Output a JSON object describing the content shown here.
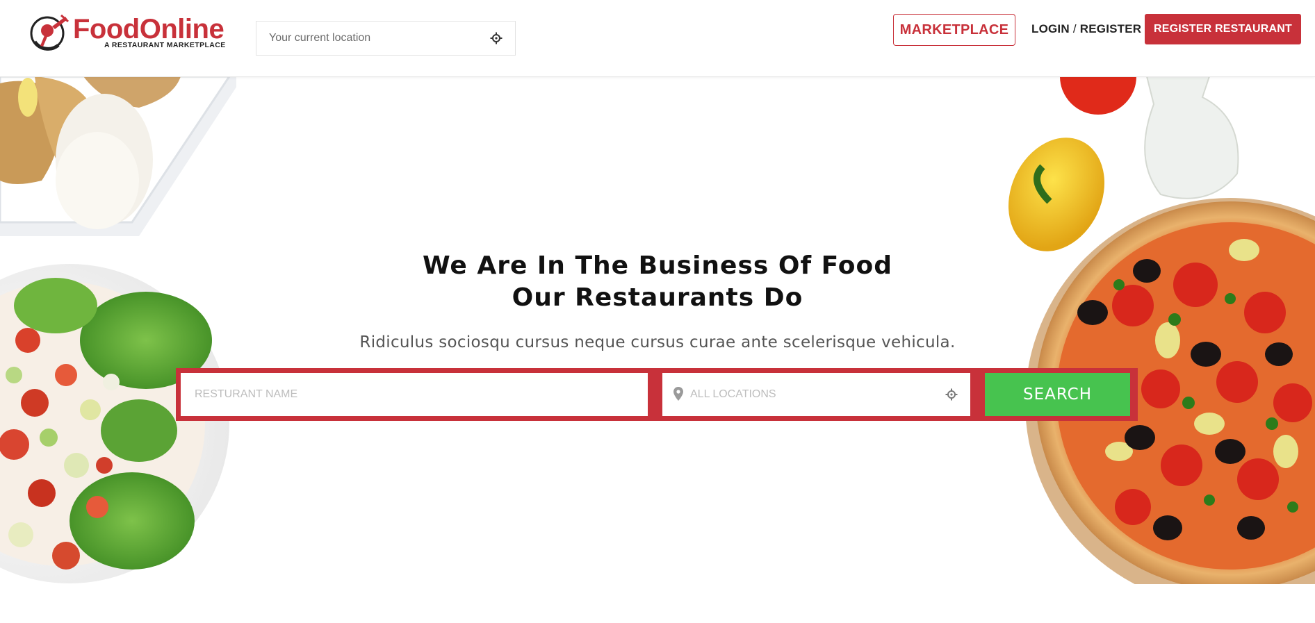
{
  "header": {
    "logo_name": "FoodOnline",
    "logo_tagline": "A RESTAURANT MARKETPLACE",
    "location_placeholder": "Your current location",
    "marketplace_label": "MARKETPLACE",
    "login_label": "LOGIN",
    "login_separator": "/",
    "register_label": "REGISTER",
    "register_restaurant_label": "REGISTER RESTAURANT"
  },
  "hero": {
    "headline_line1": "We Are In The Business Of Food",
    "headline_line2": "Our Restaurants Do",
    "subheading": "Ridiculus sociosqu cursus neque cursus curae ante scelerisque vehicula.",
    "search": {
      "name_placeholder": "RESTURANT NAME",
      "location_placeholder": "ALL LOCATIONS",
      "button_label": "SEARCH"
    }
  },
  "colors": {
    "brand_red": "#c8313a",
    "search_green": "#47c34f"
  },
  "icons": [
    "locate-target-icon",
    "map-pin-icon"
  ]
}
